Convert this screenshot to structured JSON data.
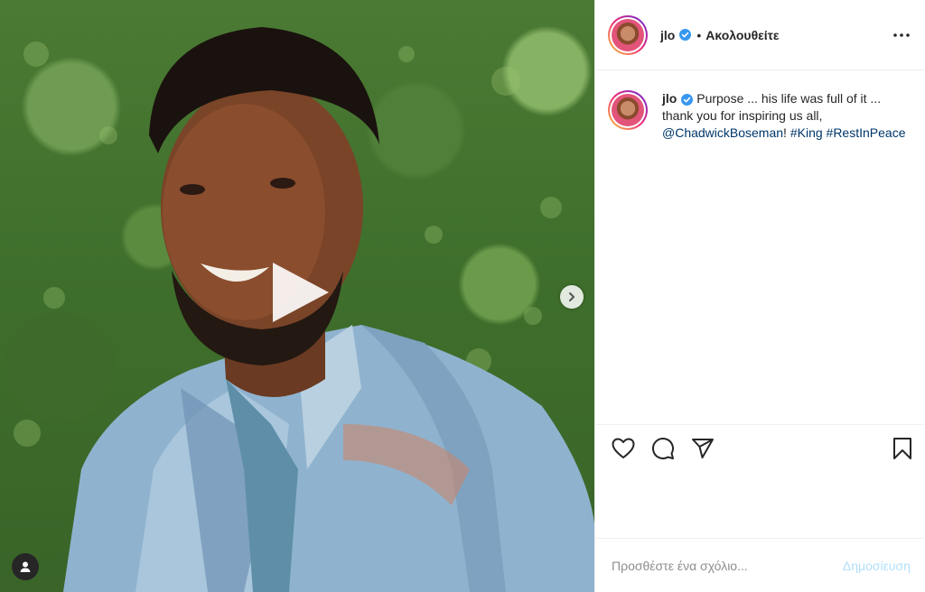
{
  "header": {
    "username": "jlo",
    "separator": "•",
    "follow_status": "Ακολουθείτε"
  },
  "caption": {
    "username": "jlo",
    "text_1": "Purpose ... his life was full of it ... thank you for inspiring us all, ",
    "mention": "@ChadwickBoseman",
    "text_2": "! ",
    "hashtag_1": "#King",
    "space": " ",
    "hashtag_2": "#RestInPeace"
  },
  "comment": {
    "placeholder": "Προσθέστε ένα σχόλιο...",
    "post_label": "Δημοσίευση"
  },
  "colors": {
    "verified": "#3897f0",
    "link": "#00376b",
    "post_disabled": "#b2dffc"
  },
  "icons": {
    "play": "play-icon",
    "next": "chevron-right-icon",
    "tags": "user-icon",
    "more": "more-horizontal-icon",
    "like": "heart-icon",
    "comment": "comment-icon",
    "share": "send-icon",
    "save": "bookmark-icon"
  }
}
